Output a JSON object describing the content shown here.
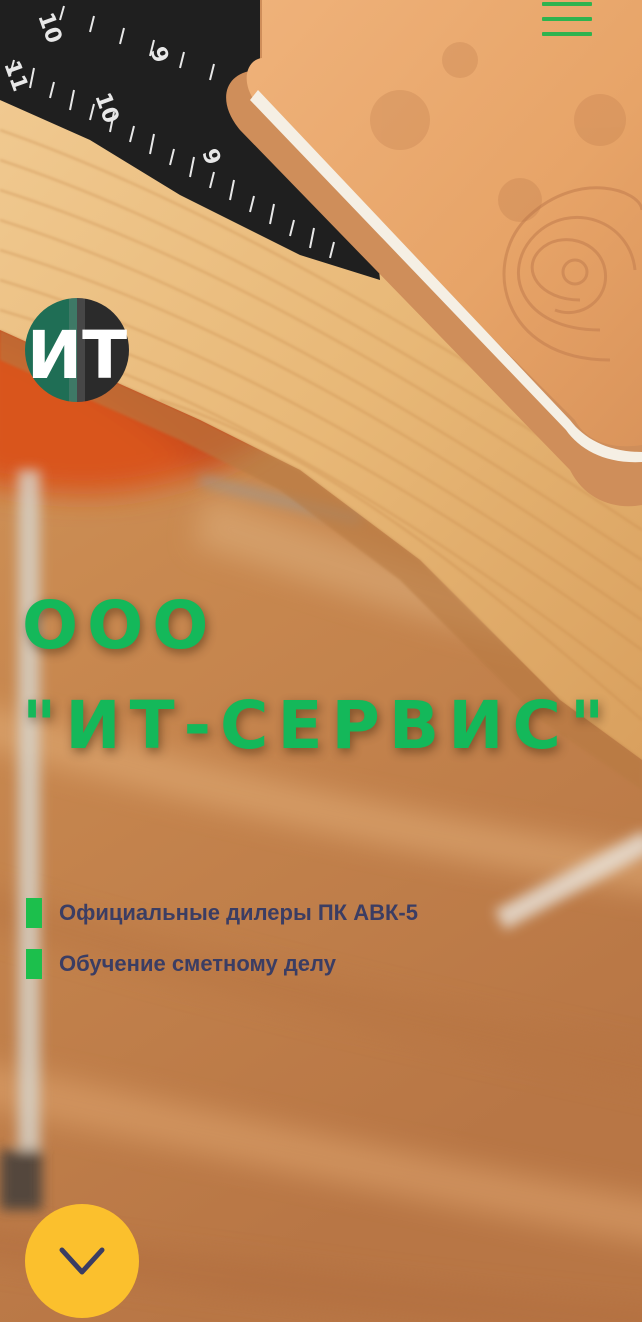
{
  "header": {
    "menu_icon": "hamburger-menu-icon",
    "accent_color": "#2fb34f"
  },
  "logo": {
    "text": "ИТ",
    "icon": "company-logo"
  },
  "hero": {
    "title_line1": "ООО",
    "title_line2": "\"ИТ-СЕРВИС\"",
    "title_color": "#14b85a",
    "features": [
      {
        "label": "Официальные дилеры ПК АВК-5"
      },
      {
        "label": "Обучение сметному делу"
      }
    ],
    "marker_color": "#1cbf4c"
  },
  "scroll_button": {
    "icon": "chevron-down-icon",
    "color": "#fbc02d"
  }
}
